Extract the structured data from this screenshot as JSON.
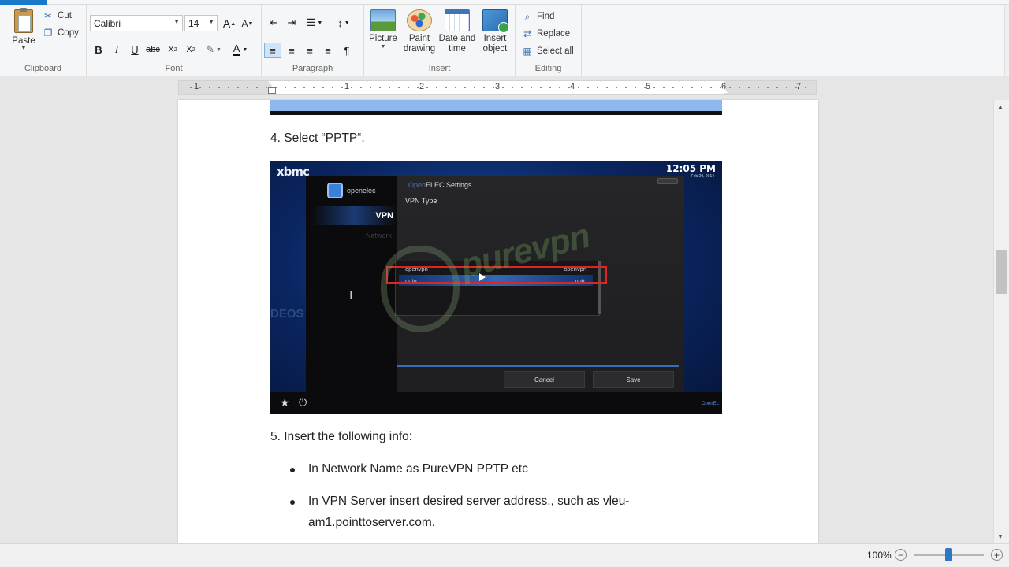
{
  "ribbon": {
    "clipboard": {
      "label": "Clipboard",
      "paste": "Paste",
      "cut": "Cut",
      "copy": "Copy"
    },
    "font": {
      "label": "Font",
      "family": "Calibri",
      "size": "14"
    },
    "paragraph": {
      "label": "Paragraph"
    },
    "insert": {
      "label": "Insert",
      "picture": "Picture",
      "paint_l1": "Paint",
      "paint_l2": "drawing",
      "date_l1": "Date and",
      "date_l2": "time",
      "object_l1": "Insert",
      "object_l2": "object"
    },
    "editing": {
      "label": "Editing",
      "find": "Find",
      "replace": "Replace",
      "select_all": "Select all"
    }
  },
  "ruler": {
    "numbers": [
      "1",
      "1",
      "2",
      "3",
      "4",
      "5",
      "6",
      "7"
    ]
  },
  "document": {
    "step4": "4. Select “PPTP“.",
    "step5": "5. Insert the following info:",
    "bullet1": "In Network Name as PureVPN PPTP etc",
    "bullet2_l1": "In VPN Server insert desired server address., such as vleu-",
    "bullet2_l2": "am1.pointtoserver.com."
  },
  "screenshot": {
    "logo": "xbmc",
    "time": "12:05 PM",
    "date": "Feb 20, 2014",
    "brand": "openelec",
    "side_vpn": "VPN",
    "side_network": "Network",
    "panel_title_muted": "Open",
    "panel_title": "ELEC Settings",
    "field_label": "VPN Type",
    "opt1_left": "openvpn",
    "opt1_right": "openvpn",
    "opt2_left": "pptp",
    "opt2_right": "pptp",
    "cancel": "Cancel",
    "save": "Save",
    "videos": "DEOS",
    "corner": "OpenEL",
    "watermark": "purevpn"
  },
  "status": {
    "zoom": "100%"
  },
  "colors": {
    "accent": "#1979ca",
    "highlight_red": "#e02424"
  }
}
